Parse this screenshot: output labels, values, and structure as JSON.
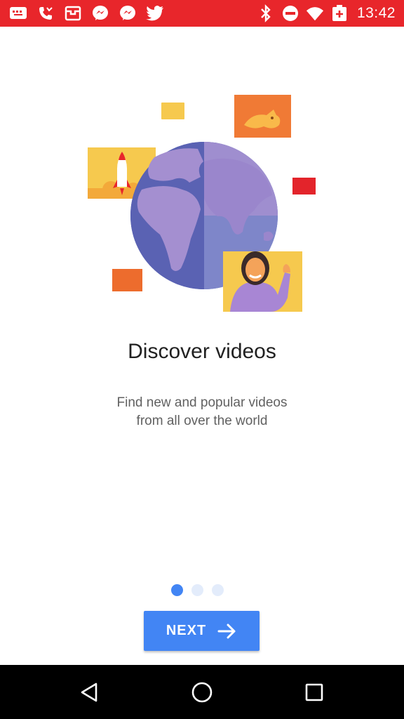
{
  "status_bar": {
    "time": "13:42",
    "color": "#e8262b",
    "left_icons": [
      "chat-icon",
      "missed-call-icon",
      "email-icon",
      "messenger-icon",
      "messenger-icon",
      "twitter-icon"
    ],
    "right_icons": [
      "bluetooth-icon",
      "do-not-disturb-icon",
      "wifi-icon",
      "battery-charging-icon"
    ]
  },
  "onboarding": {
    "title": "Discover videos",
    "subtitle_line1": "Find new and popular videos",
    "subtitle_line2": "from all over the world",
    "page_indicator": {
      "total": 3,
      "active_index": 0
    },
    "next_label": "NEXT",
    "accent_color": "#4285f4"
  },
  "nav_bar": {
    "icons": [
      "back-icon",
      "home-icon",
      "recents-icon"
    ]
  }
}
